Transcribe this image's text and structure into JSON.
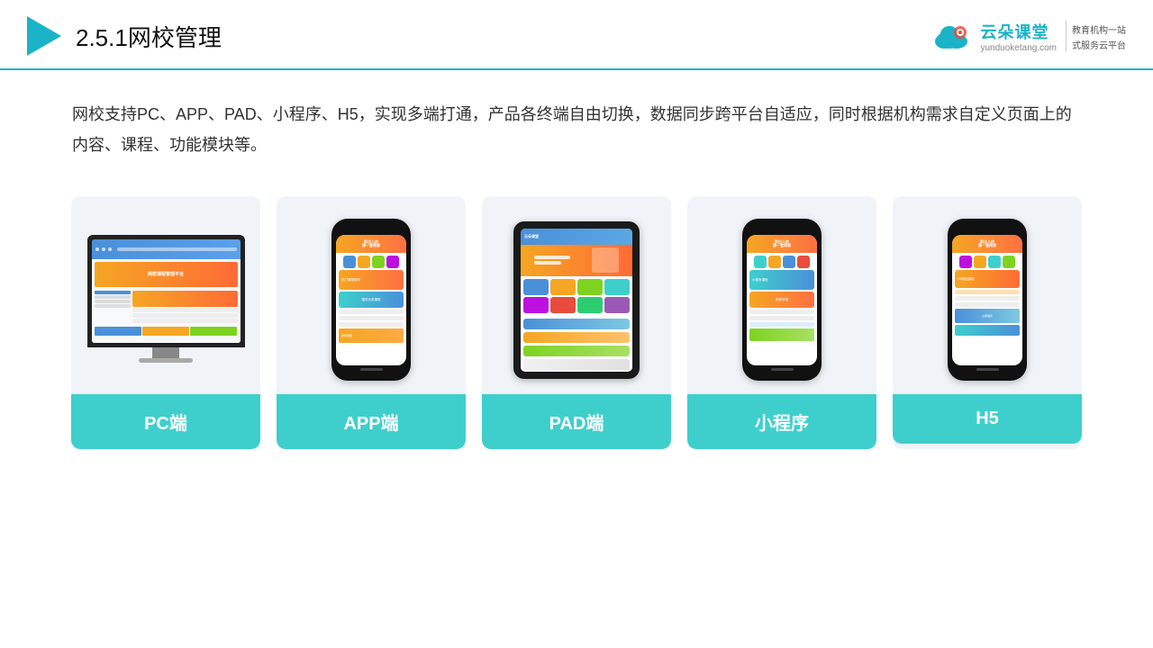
{
  "header": {
    "title_prefix": "2.5.1",
    "title_main": "网校管理",
    "logo_brand": "云朵课堂",
    "logo_url": "yunduoketang.com",
    "logo_tagline1": "教育机构一站",
    "logo_tagline2": "式服务云平台"
  },
  "description": {
    "text": "网校支持PC、APP、PAD、小程序、H5，实现多端打通，产品各终端自由切换，数据同步跨平台自适应，同时根据机构需求自定义页面上的内容、课程、功能模块等。"
  },
  "cards": [
    {
      "id": "pc",
      "label": "PC端"
    },
    {
      "id": "app",
      "label": "APP端"
    },
    {
      "id": "pad",
      "label": "PAD端"
    },
    {
      "id": "miniapp",
      "label": "小程序"
    },
    {
      "id": "h5",
      "label": "H5"
    }
  ],
  "colors": {
    "teal": "#3ecfcc",
    "blue": "#4a90d9",
    "accent": "#f5a623",
    "header_line": "#1ab3c8"
  }
}
